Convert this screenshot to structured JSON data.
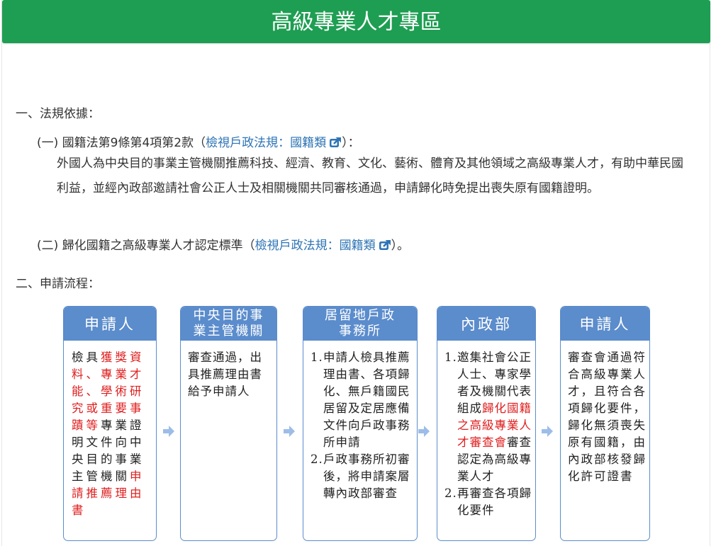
{
  "page_title": "高級專業人才專區",
  "section1": {
    "heading": "一、法規依據：",
    "item1": {
      "prefix": "(一) 國籍法第9條第4項第2款（",
      "link": "檢視戶政法規：國籍類",
      "suffix": "）：",
      "icon": "external-link-icon"
    },
    "paragraph": "外國人為中央目的事業主管機關推薦科技、經濟、教育、文化、藝術、體育及其他領域之高級專業人才，有助中華民國利益，並經內政部邀請社會公正人士及相關機關共同審核通過，申請歸化時免提出喪失原有國籍證明。",
    "item2": {
      "prefix": "(二) 歸化國籍之高級專業人才認定標準（",
      "link": "檢視戶政法規：國籍類",
      "suffix": "）。",
      "icon": "external-link-icon"
    }
  },
  "section2": {
    "heading": "二、申請流程："
  },
  "flow": {
    "accent_color": "#5b8ccc",
    "highlight_color": "#e02020",
    "box1": {
      "title": "申請人",
      "t1": "檢具",
      "r1": "獲獎資料、專業才能、學術研究或重要事蹟等",
      "t2": "專業證明文件向中央目的事業主管機關",
      "r2": "申請推薦理由書"
    },
    "box2": {
      "title": "中央目的事業主管機關",
      "body": "審查通過，出具推薦理由書給予申請人"
    },
    "box3": {
      "title": "居留地戶政事務所",
      "step1_num": "1.",
      "step1": "申請人檢具推薦理由書、各項歸化、無戶籍國民居留及定居應備文件向戶政事務所申請",
      "step2_num": "2.",
      "step2": "戶政事務所初審後，將申請案層轉內政部審查"
    },
    "box4": {
      "title": "內政部",
      "step1_num": "1.",
      "s1a": "邀集社會公正人士、專家學者及機關代表組成",
      "s1r": "歸化國籍之高級專業人才審查會",
      "s1b": "審查認定為高級專業人才",
      "step2_num": "2.",
      "step2": "再審查各項歸化要件"
    },
    "box5": {
      "title": "申請人",
      "body": "審查會通過符合高級專業人才，且符合各項歸化要件，歸化無須喪失原有國籍，由內政部核發歸化許可證書"
    },
    "arrow_icon": "right-arrow-icon"
  }
}
